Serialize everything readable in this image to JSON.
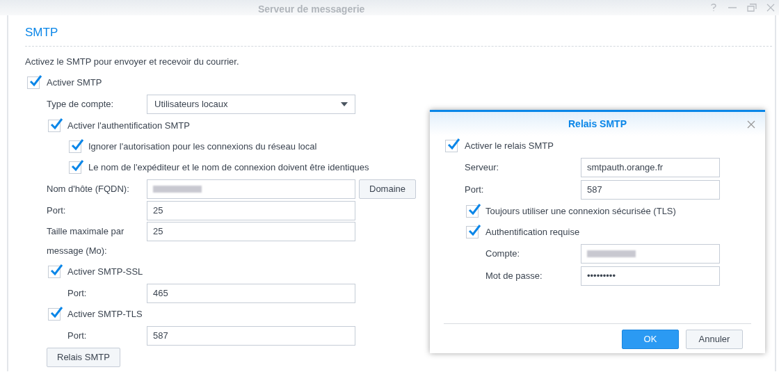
{
  "window": {
    "title": "Serveur de messagerie"
  },
  "smtp": {
    "heading": "SMTP",
    "description": "Activez le SMTP pour envoyer et recevoir du courrier.",
    "enable": {
      "label": "Activer SMTP",
      "checked": true
    },
    "account_type": {
      "label": "Type de compte:",
      "value": "Utilisateurs locaux"
    },
    "auth": {
      "label": "Activer l'authentification SMTP",
      "checked": true,
      "children": [
        {
          "label": "Ignorer l'autorisation pour les connexions du réseau local",
          "checked": true
        },
        {
          "label": "Le nom de l'expéditeur et le nom de connexion doivent être identiques",
          "checked": true
        }
      ]
    },
    "hostname": {
      "label": "Nom d'hôte (FQDN):",
      "button": "Domaine"
    },
    "port": {
      "label": "Port:",
      "value": "25"
    },
    "max_size": {
      "label": "Taille maximale par message (Mo):",
      "value": "25"
    },
    "ssl": {
      "label": "Activer SMTP-SSL",
      "checked": true,
      "port_label": "Port:",
      "port_value": "465"
    },
    "tls": {
      "label": "Activer SMTP-TLS",
      "checked": true,
      "port_label": "Port:",
      "port_value": "587"
    },
    "relay_button": "Relais SMTP"
  },
  "dialog": {
    "title": "Relais SMTP",
    "enable": {
      "label": "Activer le relais SMTP",
      "checked": true
    },
    "server": {
      "label": "Serveur:",
      "value": "smtpauth.orange.fr"
    },
    "port": {
      "label": "Port:",
      "value": "587"
    },
    "tls": {
      "label": "Toujours utiliser une connexion sécurisée (TLS)",
      "checked": true
    },
    "auth": {
      "label": "Authentification requise",
      "checked": true
    },
    "account": {
      "label": "Compte:"
    },
    "password": {
      "label": "Mot de passe:",
      "value": "•••••••••"
    },
    "buttons": [
      {
        "label": "OK",
        "kind": "primary"
      },
      {
        "label": "Annuler",
        "kind": "secondary"
      }
    ]
  }
}
